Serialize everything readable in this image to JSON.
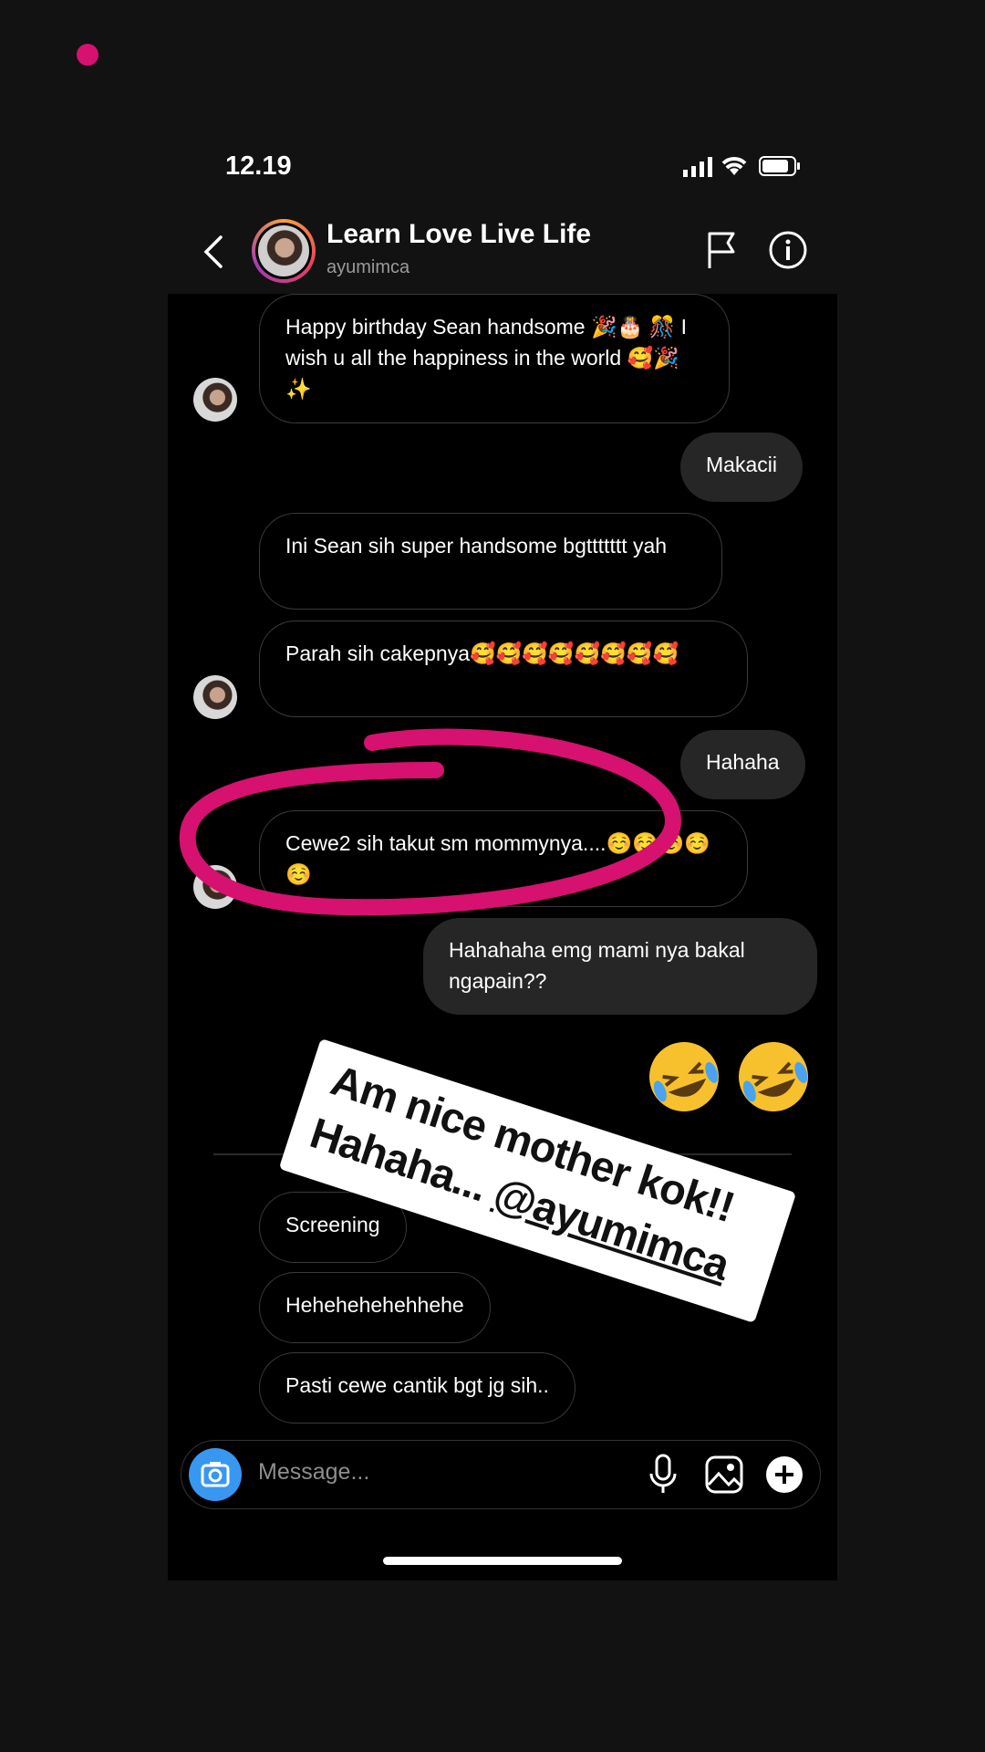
{
  "status": {
    "time": "12.19"
  },
  "header": {
    "title": "Learn Love Live Life",
    "username": "ayumimca"
  },
  "messages": [
    {
      "dir": "in",
      "text": "Happy birthday Sean handsome 🎉🎂 🎊 I wish u all the happiness in the world 🥰🎉✨"
    },
    {
      "dir": "out",
      "text": "Makacii"
    },
    {
      "dir": "in",
      "text": "Ini Sean sih super handsome bgttttttt yah"
    },
    {
      "dir": "in",
      "text": "Parah sih cakepnya🥰🥰🥰🥰🥰🥰🥰🥰"
    },
    {
      "dir": "out",
      "text": "Hahaha"
    },
    {
      "dir": "in",
      "text": "Cewe2 sih takut sm mommynya....☺️☺️☺️☺️☺️"
    },
    {
      "dir": "out",
      "text": "Hahahaha emg mami nya bakal ngapain??"
    },
    {
      "dir": "in",
      "text": "Screening"
    },
    {
      "dir": "in",
      "text": "Hehehehehehhehe"
    },
    {
      "dir": "in",
      "text": "Pasti cewe cantik bgt jg sih.."
    }
  ],
  "sticker": {
    "line1": "Am nice mother kok!!",
    "line2_prefix": "Hahaha... ",
    "mention": "@ayumimca"
  },
  "composer": {
    "placeholder": "Message..."
  },
  "colors": {
    "highlight": "#d6116f",
    "outgoing_bubble": "#262626",
    "camera": "#3897f0"
  },
  "icons": [
    "back-icon",
    "flag-icon",
    "info-icon",
    "camera-icon",
    "microphone-icon",
    "gallery-icon",
    "plus-icon",
    "rofl-emoji"
  ]
}
